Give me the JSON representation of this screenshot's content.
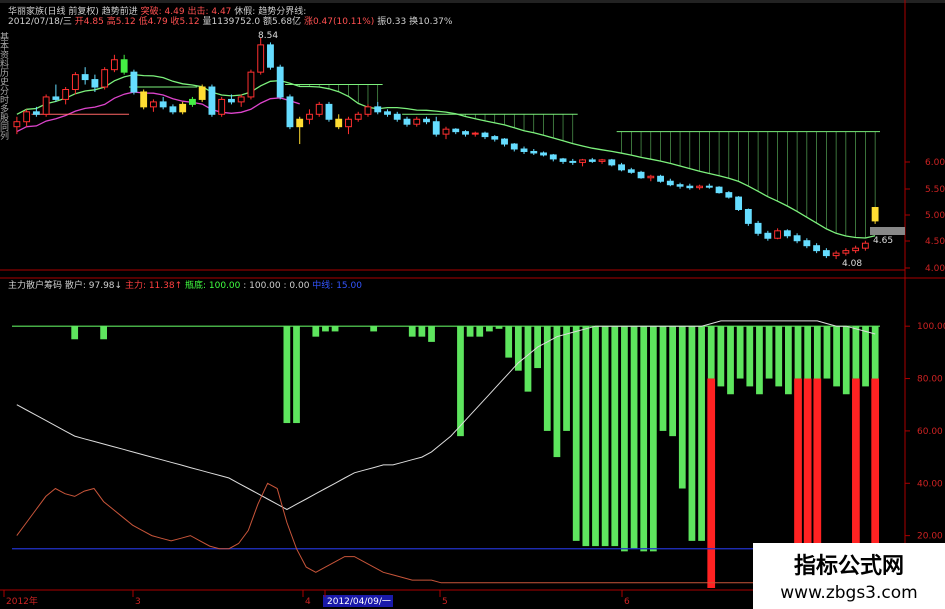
{
  "header": {
    "line1": [
      {
        "text": "华丽家族(日线 前复权)",
        "color": "#cfcfcf"
      },
      {
        "text": "趋势前进",
        "color": "#cfcfcf"
      },
      {
        "text": "突破: 4.49",
        "color": "#ff5050"
      },
      {
        "text": "出击: 4.47",
        "color": "#ff5050"
      },
      {
        "text": "休假:",
        "color": "#cfcfcf"
      },
      {
        "text": "趋势分界线:",
        "color": "#cfcfcf"
      }
    ],
    "line2": [
      {
        "text": "2012/07/18/三",
        "color": "#cfcfcf"
      },
      {
        "text": "开4.85",
        "color": "#ff5050"
      },
      {
        "text": "高5.12",
        "color": "#ff5050"
      },
      {
        "text": "低4.79",
        "color": "#ff5050"
      },
      {
        "text": "收5.12",
        "color": "#ff5050"
      },
      {
        "text": "量1139752.0",
        "color": "#cfcfcf"
      },
      {
        "text": "额5.68亿",
        "color": "#cfcfcf"
      },
      {
        "text": "涨0.47(10.11%)",
        "color": "#ff5050"
      },
      {
        "text": "振0.33",
        "color": "#cfcfcf"
      },
      {
        "text": "换10.37%",
        "color": "#cfcfcf"
      }
    ],
    "price_marker_high": "8.54",
    "price_marker_low": "4.08",
    "last_price_label": "4.65",
    "left_side_labels": [
      "基本资料",
      "历史分时",
      "多股同列"
    ]
  },
  "indicator": {
    "name": "主力散户筹码",
    "values": [
      {
        "text": "散户: 97.98↓",
        "color": "#cfcfcf"
      },
      {
        "text": "主力: 11.38↑",
        "color": "#ff4040"
      },
      {
        "text": "瓶底: 100.00",
        "color": "#40ff40"
      },
      {
        "text": ": 100.00 : 0.00",
        "color": "#cfcfcf"
      },
      {
        "text": "中线: 15.00",
        "color": "#3355ff"
      }
    ]
  },
  "price_axis": [
    "6.00",
    "5.50",
    "5.00",
    "4.50",
    "4.00"
  ],
  "indicator_axis": [
    "100.00",
    "80.00",
    "60.00",
    "40.00",
    "20.00"
  ],
  "time_axis": [
    "2012年",
    "3",
    "4",
    "2012/04/09/一",
    "5",
    "6"
  ],
  "watermark": {
    "cn": "指标公式网",
    "url": "www.zbgs3.com"
  },
  "colors": {
    "up": "#ff3030",
    "down": "#66ddff",
    "yellow": "#ffdd33",
    "green": "#44ee44",
    "ma": "#7cf07c",
    "magenta": "#dd44cc",
    "bar_green": "#5ee55e",
    "bar_red": "#ff2222",
    "mid": "#2233cc",
    "axis": "#aa0000"
  },
  "chart_data": [
    {
      "type": "candlestick",
      "title": "",
      "ylim": [
        4.0,
        6.3
      ],
      "candles": [
        [
          6.75,
          6.95,
          6.6,
          6.85
        ],
        [
          6.85,
          7.1,
          6.75,
          7.05
        ],
        [
          7.05,
          7.15,
          6.95,
          7.0
        ],
        [
          7.0,
          7.4,
          6.95,
          7.35
        ],
        [
          7.35,
          7.6,
          7.25,
          7.3
        ],
        [
          7.3,
          7.55,
          7.2,
          7.5
        ],
        [
          7.5,
          7.85,
          7.4,
          7.8
        ],
        [
          7.8,
          7.95,
          7.6,
          7.7
        ],
        [
          7.7,
          7.8,
          7.45,
          7.55
        ],
        [
          7.55,
          7.95,
          7.5,
          7.9
        ],
        [
          7.9,
          8.2,
          7.85,
          8.1
        ],
        [
          8.1,
          8.2,
          7.8,
          7.85
        ],
        [
          7.85,
          7.9,
          7.4,
          7.45
        ],
        [
          7.45,
          7.5,
          7.1,
          7.15
        ],
        [
          7.15,
          7.3,
          7.05,
          7.25
        ],
        [
          7.25,
          7.35,
          7.1,
          7.15
        ],
        [
          7.15,
          7.2,
          7.0,
          7.05
        ],
        [
          7.05,
          7.25,
          7.0,
          7.2
        ],
        [
          7.2,
          7.35,
          7.15,
          7.3
        ],
        [
          7.3,
          7.6,
          7.25,
          7.55
        ],
        [
          7.55,
          7.6,
          6.95,
          7.0
        ],
        [
          7.0,
          7.35,
          6.95,
          7.3
        ],
        [
          7.3,
          7.4,
          7.2,
          7.25
        ],
        [
          7.25,
          7.4,
          7.15,
          7.35
        ],
        [
          7.35,
          7.9,
          7.3,
          7.85
        ],
        [
          7.85,
          8.54,
          7.8,
          8.4
        ],
        [
          8.4,
          8.45,
          7.9,
          7.95
        ],
        [
          7.95,
          8.0,
          7.3,
          7.35
        ],
        [
          7.35,
          7.4,
          6.7,
          6.75
        ],
        [
          6.75,
          6.95,
          6.4,
          6.9
        ],
        [
          6.9,
          7.1,
          6.8,
          7.0
        ],
        [
          7.0,
          7.25,
          6.95,
          7.2
        ],
        [
          7.2,
          7.25,
          6.85,
          6.9
        ],
        [
          6.9,
          7.0,
          6.7,
          6.75
        ],
        [
          6.75,
          6.95,
          6.6,
          6.9
        ],
        [
          6.9,
          7.05,
          6.85,
          7.0
        ],
        [
          7.0,
          7.2,
          6.95,
          7.15
        ],
        [
          7.15,
          7.25,
          7.0,
          7.05
        ],
        [
          7.05,
          7.1,
          6.95,
          7.0
        ],
        [
          7.0,
          7.05,
          6.85,
          6.9
        ],
        [
          6.9,
          6.95,
          6.75,
          6.8
        ],
        [
          6.8,
          6.95,
          6.75,
          6.9
        ],
        [
          6.9,
          6.95,
          6.8,
          6.85
        ],
        [
          6.85,
          6.95,
          6.55,
          6.6
        ],
        [
          6.6,
          6.75,
          6.5,
          6.7
        ],
        [
          6.7,
          6.72,
          6.6,
          6.65
        ],
        [
          6.65,
          6.68,
          6.55,
          6.6
        ],
        [
          6.6,
          6.65,
          6.55,
          6.62
        ],
        [
          6.62,
          6.65,
          6.5,
          6.55
        ],
        [
          6.55,
          6.58,
          6.45,
          6.5
        ],
        [
          6.5,
          6.52,
          6.35,
          6.4
        ],
        [
          6.4,
          6.42,
          6.25,
          6.3
        ],
        [
          6.3,
          6.35,
          6.2,
          6.25
        ],
        [
          6.25,
          6.3,
          6.18,
          6.22
        ],
        [
          6.22,
          6.25,
          6.15,
          6.18
        ],
        [
          6.18,
          6.2,
          6.05,
          6.1
        ],
        [
          6.1,
          6.12,
          6.0,
          6.05
        ],
        [
          6.05,
          6.1,
          5.98,
          6.03
        ],
        [
          6.03,
          6.1,
          5.95,
          6.08
        ],
        [
          6.08,
          6.12,
          6.02,
          6.05
        ],
        [
          6.05,
          6.1,
          6.0,
          6.08
        ],
        [
          6.08,
          6.1,
          5.95,
          5.98
        ],
        [
          5.98,
          6.02,
          5.85,
          5.88
        ],
        [
          5.88,
          5.92,
          5.8,
          5.83
        ],
        [
          5.83,
          5.86,
          5.7,
          5.72
        ],
        [
          5.72,
          5.78,
          5.65,
          5.75
        ],
        [
          5.75,
          5.78,
          5.62,
          5.65
        ],
        [
          5.65,
          5.7,
          5.55,
          5.58
        ],
        [
          5.58,
          5.62,
          5.5,
          5.55
        ],
        [
          5.55,
          5.6,
          5.48,
          5.52
        ],
        [
          5.52,
          5.58,
          5.48,
          5.55
        ],
        [
          5.55,
          5.6,
          5.5,
          5.53
        ],
        [
          5.53,
          5.55,
          5.4,
          5.42
        ],
        [
          5.42,
          5.45,
          5.3,
          5.33
        ],
        [
          5.33,
          5.35,
          5.05,
          5.08
        ],
        [
          5.08,
          5.1,
          4.75,
          4.8
        ],
        [
          4.8,
          4.85,
          4.55,
          4.6
        ],
        [
          4.6,
          4.65,
          4.45,
          4.5
        ],
        [
          4.5,
          4.7,
          4.48,
          4.65
        ],
        [
          4.65,
          4.68,
          4.5,
          4.55
        ],
        [
          4.55,
          4.6,
          4.4,
          4.45
        ],
        [
          4.45,
          4.5,
          4.3,
          4.35
        ],
        [
          4.35,
          4.4,
          4.2,
          4.25
        ],
        [
          4.25,
          4.3,
          4.1,
          4.15
        ],
        [
          4.15,
          4.25,
          4.08,
          4.2
        ],
        [
          4.2,
          4.3,
          4.15,
          4.25
        ],
        [
          4.25,
          4.35,
          4.2,
          4.3
        ],
        [
          4.3,
          4.45,
          4.25,
          4.4
        ],
        [
          4.85,
          5.12,
          4.79,
          5.12
        ]
      ]
    },
    {
      "type": "bar+line",
      "title": "",
      "ylim": [
        0,
        110
      ],
      "green_bars": [
        100,
        100,
        100,
        100,
        100,
        100,
        95,
        100,
        100,
        95,
        100,
        100,
        100,
        100,
        100,
        100,
        100,
        100,
        100,
        100,
        100,
        100,
        100,
        100,
        100,
        100,
        100,
        100,
        63,
        63,
        100,
        96,
        98,
        98,
        100,
        100,
        100,
        98,
        100,
        100,
        100,
        96,
        96,
        94,
        100,
        100,
        58,
        96,
        96,
        98,
        99,
        88,
        83,
        75,
        84,
        60,
        50,
        60,
        18,
        16,
        16,
        16,
        16,
        14,
        15,
        14,
        14,
        60,
        58,
        38,
        18,
        18,
        100,
        100,
        100,
        100,
        100,
        100,
        100,
        100,
        100,
        100,
        100,
        100,
        100,
        100,
        100,
        100,
        100,
        100
      ],
      "red_bars": [
        0,
        0,
        0,
        0,
        0,
        0,
        0,
        0,
        0,
        0,
        0,
        0,
        0,
        0,
        0,
        0,
        0,
        0,
        0,
        0,
        0,
        0,
        0,
        0,
        0,
        0,
        0,
        0,
        0,
        0,
        0,
        0,
        0,
        0,
        0,
        0,
        0,
        0,
        0,
        0,
        0,
        0,
        0,
        0,
        0,
        0,
        0,
        0,
        0,
        0,
        0,
        0,
        0,
        0,
        0,
        0,
        0,
        0,
        0,
        0,
        0,
        0,
        0,
        0,
        0,
        0,
        0,
        0,
        0,
        0,
        0,
        0,
        80,
        0,
        0,
        0,
        0,
        0,
        0,
        0,
        0,
        80,
        80,
        80,
        0,
        0,
        0,
        80,
        0,
        80,
        0,
        0,
        0,
        0,
        0,
        0
      ],
      "white_line": [
        70,
        68,
        66,
        64,
        62,
        60,
        58,
        57,
        56,
        55,
        54,
        53,
        52,
        51,
        50,
        49,
        48,
        47,
        46,
        45,
        44,
        43,
        42,
        40,
        38,
        36,
        34,
        32,
        30,
        32,
        34,
        36,
        38,
        40,
        42,
        44,
        45,
        46,
        47,
        47,
        48,
        49,
        50,
        52,
        55,
        58,
        62,
        66,
        70,
        74,
        78,
        82,
        86,
        89,
        92,
        94,
        96,
        97,
        98,
        99,
        100,
        100,
        100,
        100,
        100,
        100,
        100,
        100,
        100,
        100,
        100,
        100,
        101,
        102,
        102,
        102,
        102,
        102,
        102,
        102,
        102,
        102,
        102,
        102,
        101,
        100,
        100,
        99,
        98,
        97
      ],
      "orange_line": [
        20,
        25,
        30,
        35,
        38,
        36,
        35,
        37,
        38,
        33,
        30,
        27,
        24,
        22,
        20,
        19,
        18,
        19,
        20,
        18,
        16,
        15,
        15,
        17,
        22,
        32,
        40,
        38,
        25,
        15,
        8,
        6,
        8,
        10,
        12,
        12,
        10,
        8,
        6,
        5,
        4,
        3,
        3,
        3,
        2,
        2,
        2,
        2,
        2,
        2,
        2,
        2,
        2,
        2,
        2,
        2,
        2,
        2,
        2,
        2,
        2,
        2,
        2,
        2,
        2,
        2,
        2,
        2,
        2,
        2,
        2,
        2,
        2,
        2,
        2,
        2,
        2,
        2,
        2,
        2,
        2,
        2,
        2,
        2,
        2,
        2,
        2,
        2,
        2,
        2
      ],
      "mid_line": 15
    }
  ]
}
